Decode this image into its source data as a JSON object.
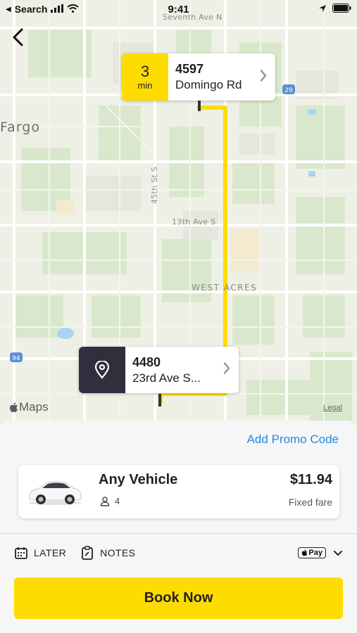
{
  "status_bar": {
    "back_app": "Search",
    "time": "9:41"
  },
  "map": {
    "streets": [
      "Seventh Ave N",
      "45th St S",
      "13th Ave S"
    ],
    "city": "Fargo",
    "district": "WEST ACRES",
    "highway_shields": [
      "29",
      "94"
    ],
    "maps_brand": "Maps",
    "legal": "Legal",
    "route_color": "#ffdc00"
  },
  "pickup": {
    "eta_value": "3",
    "eta_unit": "min",
    "number": "4597",
    "street": "Domingo Rd"
  },
  "dropoff": {
    "icon": "location-pin-icon",
    "number": "4480",
    "street": "23rd Ave S..."
  },
  "sheet": {
    "promo_label": "Add Promo Code",
    "vehicle": {
      "name": "Any Vehicle",
      "seats": "4",
      "price": "$11.94",
      "fare_type": "Fixed fare"
    },
    "options": {
      "later_label": "LATER",
      "notes_label": "NOTES"
    },
    "payment": {
      "method_label": "Pay"
    },
    "book_label": "Book Now"
  },
  "colors": {
    "accent_yellow": "#ffdc00",
    "dropoff_badge": "#2f2f3e",
    "link_blue": "#1e8ce6"
  }
}
